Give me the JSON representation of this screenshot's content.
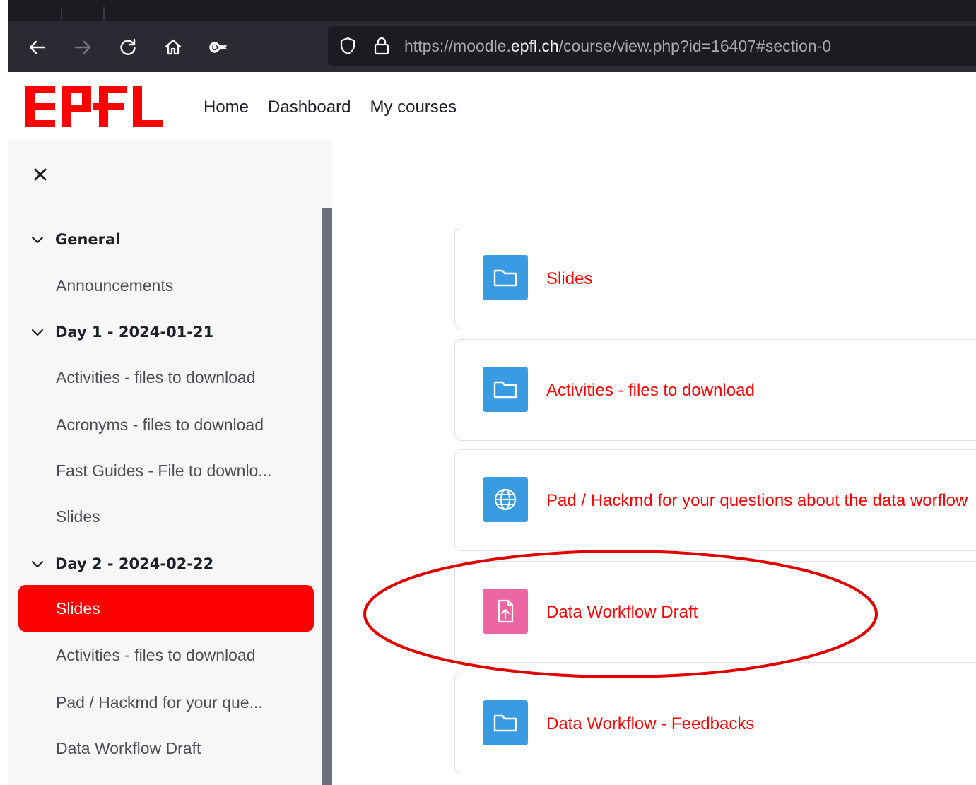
{
  "browser": {
    "url_prefix": "https://moodle.",
    "url_domain": "epfl.ch",
    "url_path": "/course/view.php?id=16407#section-0"
  },
  "header": {
    "logo_text": "EPFL",
    "nav": [
      "Home",
      "Dashboard",
      "My courses"
    ],
    "brand_color": "#ff0000"
  },
  "course_index": {
    "close_icon": "close-icon",
    "sections": [
      {
        "title": "General",
        "items": [
          "Announcements"
        ]
      },
      {
        "title": "Day 1 - 2024-01-21",
        "items": [
          "Activities - files to download",
          "Acronyms - files to download",
          "Fast Guides - File to downlo...",
          "Slides"
        ]
      },
      {
        "title": "Day 2 - 2024-02-22",
        "items": [
          "Slides",
          "Activities - files to download",
          "Pad / Hackmd for your que...",
          "Data Workflow Draft"
        ]
      }
    ],
    "active_item": "Slides"
  },
  "activities": [
    {
      "name": "Slides",
      "icon": "folder-icon",
      "icon_color": "#399be2"
    },
    {
      "name": "Activities - files to download",
      "icon": "folder-icon",
      "icon_color": "#399be2"
    },
    {
      "name": "Pad / Hackmd for your questions about the data worflow",
      "icon": "globe-icon",
      "icon_color": "#399be2"
    },
    {
      "name": "Data Workflow Draft",
      "icon": "assignment-upload-icon",
      "icon_color": "#eb66a2"
    },
    {
      "name": "Data Workflow - Feedbacks",
      "icon": "folder-icon",
      "icon_color": "#399be2"
    }
  ],
  "annotation": {
    "shape": "ellipse",
    "color": "#e00000",
    "target": "Data Workflow Draft"
  }
}
